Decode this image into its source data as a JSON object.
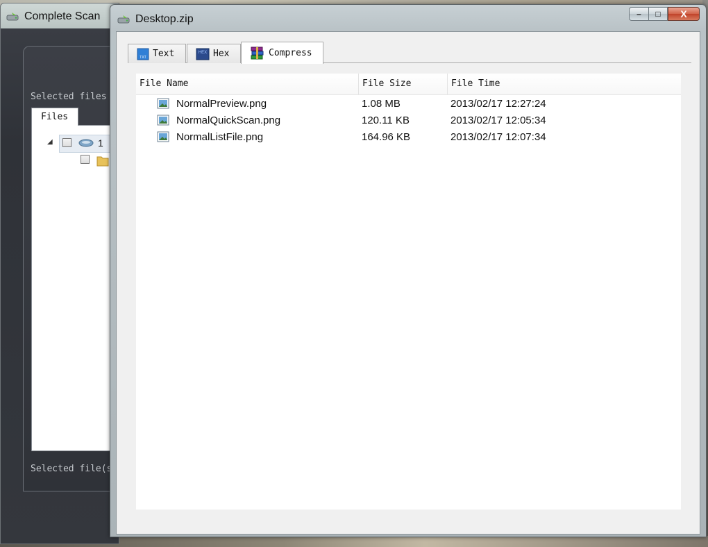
{
  "back_window": {
    "title": "Complete Scan",
    "selected_files_label": "Selected files",
    "files_tab_label": "Files",
    "tree_root_label": "1",
    "footer_label": "Selected file(s"
  },
  "front_window": {
    "title": "Desktop.zip",
    "controls": {
      "minimize": "–",
      "maximize": "□",
      "close": "X"
    },
    "tabs": [
      {
        "label": "Text",
        "icon": "text-file-icon",
        "badge": "TXT"
      },
      {
        "label": "Hex",
        "icon": "hex-file-icon",
        "badge": "HEX"
      },
      {
        "label": "Compress",
        "icon": "archive-books-icon",
        "active": true
      }
    ],
    "columns": [
      "File Name",
      "File Size",
      "File Time"
    ],
    "files": [
      {
        "name": "NormalPreview.png",
        "size": "1.08 MB",
        "time": "2013/02/17 12:27:24"
      },
      {
        "name": "NormalQuickScan.png",
        "size": "120.11 KB",
        "time": "2013/02/17 12:05:34"
      },
      {
        "name": "NormalListFile.png",
        "size": "164.96 KB",
        "time": "2013/02/17 12:07:34"
      }
    ]
  }
}
